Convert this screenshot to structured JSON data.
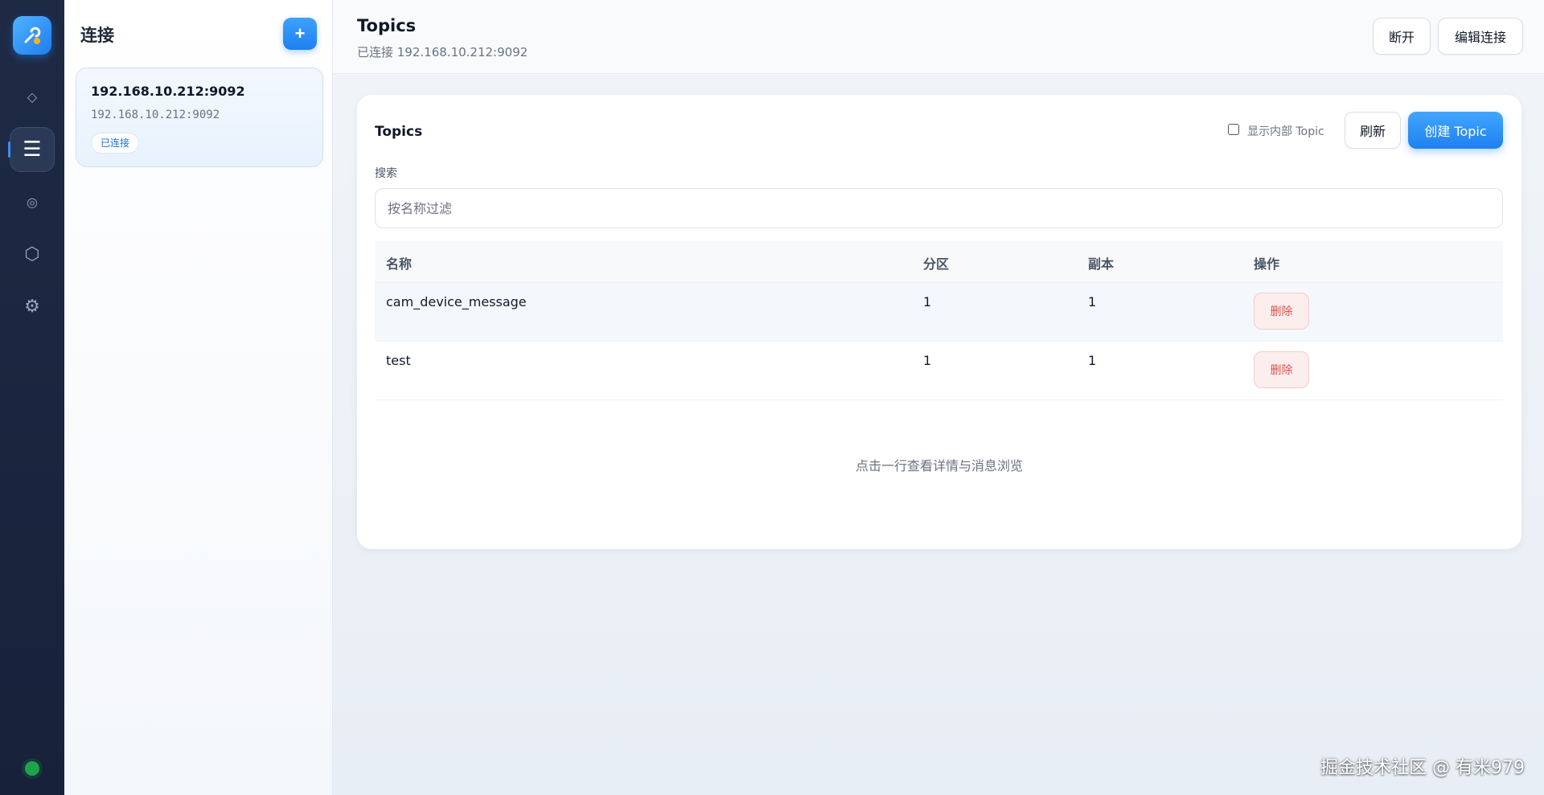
{
  "rail": {
    "items": [
      {
        "icon": "diamond-icon",
        "glyph": "◇",
        "active": false
      },
      {
        "icon": "list-icon",
        "glyph": "☰",
        "active": true
      },
      {
        "icon": "target-icon",
        "glyph": "◎",
        "active": false
      },
      {
        "icon": "hexagon-icon",
        "glyph": "⬡",
        "active": false
      },
      {
        "icon": "gear-icon",
        "glyph": "⚙",
        "active": false
      }
    ],
    "status_color": "#1fa34a"
  },
  "connections": {
    "title": "连接",
    "add_label": "+",
    "items": [
      {
        "name": "192.168.10.212:9092",
        "address": "192.168.10.212:9092",
        "status": "已连接"
      }
    ]
  },
  "header": {
    "title": "Topics",
    "subtitle": "已连接 192.168.10.212:9092",
    "disconnect_label": "断开",
    "edit_label": "编辑连接"
  },
  "topics": {
    "title": "Topics",
    "show_internal_label": "显示内部 Topic",
    "show_internal_checked": false,
    "refresh_label": "刷新",
    "create_label": "创建 Topic",
    "search_label": "搜索",
    "search_placeholder": "按名称过滤",
    "search_value": "",
    "columns": [
      "名称",
      "分区",
      "副本",
      "操作"
    ],
    "rows": [
      {
        "name": "cam_device_message",
        "partitions": "1",
        "replicas": "1",
        "action": "删除"
      },
      {
        "name": "test",
        "partitions": "1",
        "replicas": "1",
        "action": "删除"
      }
    ],
    "hint": "点击一行查看详情与消息浏览"
  },
  "colors": {
    "accent": "#1f80f0",
    "danger": "#d9534f",
    "rail_bg": "#1e2a44"
  },
  "watermark": "掘金技术社区 @ 有米979"
}
